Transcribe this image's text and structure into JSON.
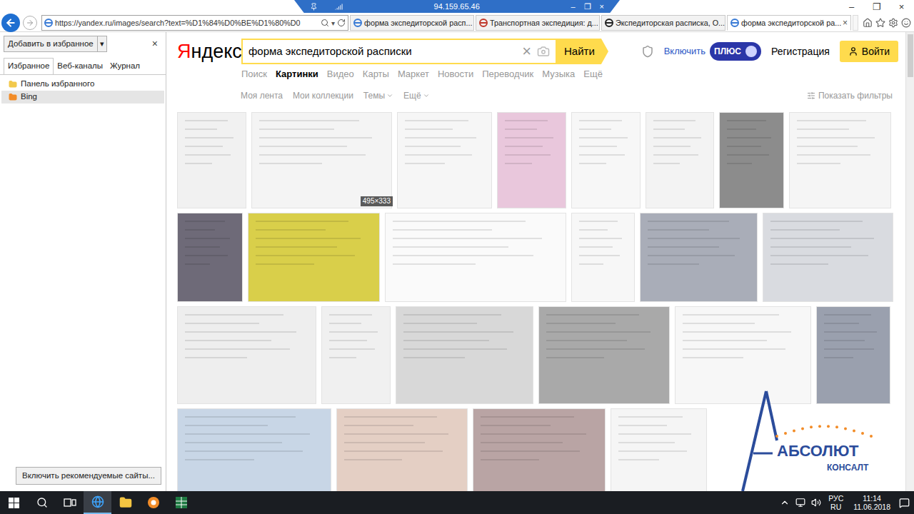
{
  "remote_session": {
    "address": "94.159.65.46",
    "controls": [
      "–",
      "❐",
      "×"
    ]
  },
  "window_controls": [
    "–",
    "❐",
    "×"
  ],
  "address_bar": {
    "url": "https://yandex.ru/images/search?text=%D1%84%D0%BE%D1%80%D0",
    "dropdown": "▾"
  },
  "tabs": [
    {
      "label": "форма экспедиторской расп...",
      "selected": false,
      "color": "#3a7bd5"
    },
    {
      "label": "Транспортная экспедиция: д...",
      "selected": false,
      "color": "#c0392b"
    },
    {
      "label": "Экспедиторская расписка, О...",
      "selected": false,
      "color": "#222222"
    },
    {
      "label": "форма экспедиторской ра...",
      "selected": true,
      "color": "#3a7bd5"
    }
  ],
  "tab_close": "×",
  "favorites": {
    "add_button": "Добавить в избранное",
    "add_dropdown": "▾",
    "close": "×",
    "tabs": [
      {
        "label": "Избранное",
        "selected": true
      },
      {
        "label": "Веб-каналы",
        "selected": false
      },
      {
        "label": "Журнал",
        "selected": false
      }
    ],
    "items": [
      {
        "label": "Панель избранного",
        "selected": false,
        "color": "#f2c94c"
      },
      {
        "label": "Bing",
        "selected": true,
        "color": "#f28c28"
      }
    ],
    "footer_button": "Включить рекомендуемые сайты..."
  },
  "yandex": {
    "logo_first": "Я",
    "logo_rest": "ндекс",
    "query": "форма экспедиторской расписки",
    "clear": "×",
    "search_button": "Найти",
    "plus_enable": "Включить",
    "plus_badge": "ПЛЮС",
    "register": "Регистрация",
    "login": "Войти"
  },
  "nav": [
    {
      "label": "Поиск",
      "selected": false
    },
    {
      "label": "Картинки",
      "selected": true
    },
    {
      "label": "Видео",
      "selected": false
    },
    {
      "label": "Карты",
      "selected": false
    },
    {
      "label": "Маркет",
      "selected": false
    },
    {
      "label": "Новости",
      "selected": false
    },
    {
      "label": "Переводчик",
      "selected": false
    },
    {
      "label": "Музыка",
      "selected": false
    },
    {
      "label": "Ещё",
      "selected": false
    }
  ],
  "subnav": [
    {
      "label": "Моя лента",
      "dropdown": false
    },
    {
      "label": "Мои коллекции",
      "dropdown": false
    },
    {
      "label": "Темы",
      "dropdown": true
    },
    {
      "label": "Ещё",
      "dropdown": true
    }
  ],
  "filters": "Показать фильтры",
  "thumbnail_rows": [
    [
      {
        "color": "#f1f1f1"
      },
      {
        "color": "#f4f4f4",
        "tooltip": "495×333"
      },
      {
        "color": "#f6f6f6"
      },
      {
        "color": "#e9c7dc"
      },
      {
        "color": "#f7f7f7"
      },
      {
        "color": "#f3f3f3"
      },
      {
        "color": "#8c8c8c"
      },
      {
        "color": "#f5f5f5"
      }
    ],
    [
      {
        "color": "#6e6a78"
      },
      {
        "color": "#d9cf4a"
      },
      {
        "color": "#fafafa"
      },
      {
        "color": "#f7f7f7"
      },
      {
        "color": "#a9adb8"
      },
      {
        "color": "#d9dbe0"
      }
    ],
    [
      {
        "color": "#eeeeee"
      },
      {
        "color": "#f0f0f0"
      },
      {
        "color": "#d8d8d8"
      },
      {
        "color": "#a9a9a9"
      },
      {
        "color": "#f7f7f7"
      },
      {
        "color": "#9aa0ae"
      }
    ],
    [
      {
        "color": "#c8d6e6"
      },
      {
        "color": "#e4cfc4"
      },
      {
        "color": "#b9a4a4"
      },
      {
        "color": "#f5f5f5"
      }
    ]
  ],
  "watermark": {
    "name": "АБСОЛЮТ",
    "subtitle": "КОНСАЛТ"
  },
  "taskbar": {
    "language": "РУС",
    "layout": "RU",
    "time": "11:14",
    "date": "11.06.2018"
  }
}
